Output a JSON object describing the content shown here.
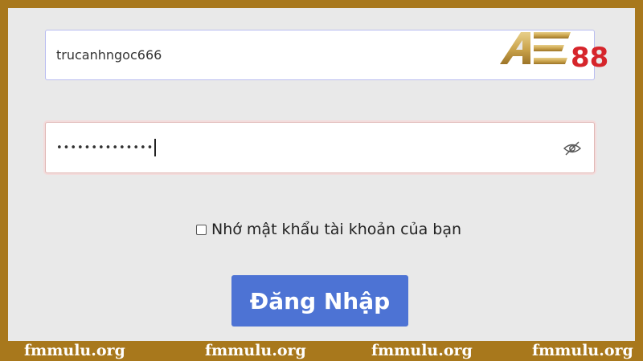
{
  "login_form": {
    "username_value": "trucanhngoc666",
    "password_mask": "••••••••••••••",
    "remember_label": "Nhớ mật khẩu tài khoản của bạn",
    "remember_checked": false,
    "submit_label": "Đăng Nhập"
  },
  "logo": {
    "text": "AE88",
    "gold_color": "#c9a24a",
    "red_color": "#d6252b"
  },
  "watermark": {
    "items": [
      "fmmulu.org",
      "fmmulu.org",
      "fmmulu.org",
      "fmmulu.org"
    ]
  },
  "colors": {
    "frame": "#a8781c",
    "panel": "#e9e9e9",
    "button": "#4d73d4"
  },
  "icons": {
    "password_toggle": "eye-slash-icon"
  }
}
